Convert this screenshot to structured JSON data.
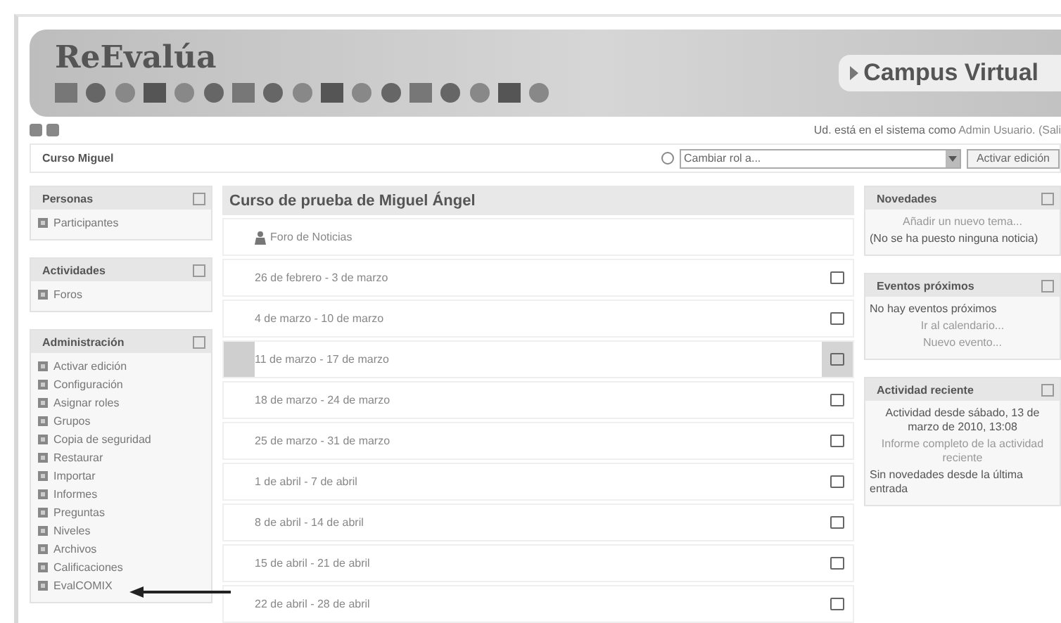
{
  "header": {
    "logo_text": "ReEvalúa",
    "campus_label": "Campus Virtual"
  },
  "login_info": {
    "text": "Ud. está en el sistema como",
    "user_link": "Admin Usuario.",
    "logout_link": "(Sali"
  },
  "breadcrumb": "Curso Miguel",
  "role_select": {
    "value": "Cambiar rol a..."
  },
  "edit_button": "Activar edición",
  "left_blocks": [
    {
      "title": "Personas",
      "items": [
        "Participantes"
      ]
    },
    {
      "title": "Actividades",
      "items": [
        "Foros"
      ]
    },
    {
      "title": "Administración",
      "items": [
        "Activar edición",
        "Configuración",
        "Asignar roles",
        "Grupos",
        "Copia de seguridad",
        "Restaurar",
        "Importar",
        "Informes",
        "Preguntas",
        "Niveles",
        "Archivos",
        "Calificaciones",
        "EvalCOMIX"
      ]
    }
  ],
  "course": {
    "title": "Curso de prueba de Miguel Ángel",
    "sections": [
      {
        "kind": "news",
        "label": "Foro de Noticias",
        "current": false
      },
      {
        "kind": "week",
        "label": "26 de febrero - 3 de marzo",
        "current": false
      },
      {
        "kind": "week",
        "label": "4 de marzo - 10 de marzo",
        "current": false
      },
      {
        "kind": "week",
        "label": "11 de marzo - 17 de marzo",
        "current": true
      },
      {
        "kind": "week",
        "label": "18 de marzo - 24 de marzo",
        "current": false
      },
      {
        "kind": "week",
        "label": "25 de marzo - 31 de marzo",
        "current": false
      },
      {
        "kind": "week",
        "label": "1 de abril - 7 de abril",
        "current": false
      },
      {
        "kind": "week",
        "label": "8 de abril - 14 de abril",
        "current": false
      },
      {
        "kind": "week",
        "label": "15 de abril - 21 de abril",
        "current": false
      },
      {
        "kind": "week",
        "label": "22 de abril - 28 de abril",
        "current": false
      }
    ]
  },
  "right_blocks": [
    {
      "title": "Novedades",
      "lines": [
        {
          "kind": "link",
          "text": "Añadir un nuevo tema..."
        },
        {
          "kind": "text",
          "text": "(No se ha puesto ninguna noticia)"
        }
      ]
    },
    {
      "title": "Eventos próximos",
      "lines": [
        {
          "kind": "text",
          "text": "No hay eventos próximos"
        },
        {
          "kind": "link",
          "text": "Ir al calendario..."
        },
        {
          "kind": "link",
          "text": "Nuevo evento..."
        }
      ]
    },
    {
      "title": "Actividad reciente",
      "lines": [
        {
          "kind": "note",
          "text": "Actividad desde sábado, 13 de marzo de 2010, 13:08"
        },
        {
          "kind": "link",
          "text": "Informe completo de la actividad reciente"
        },
        {
          "kind": "text",
          "text": "Sin novedades desde la última entrada"
        }
      ]
    }
  ]
}
